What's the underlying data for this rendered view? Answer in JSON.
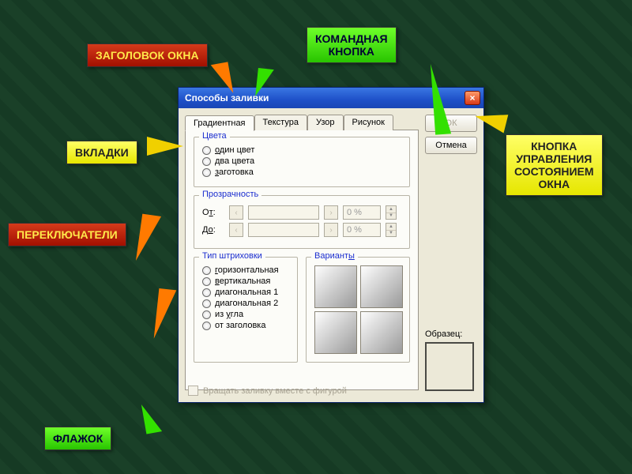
{
  "callouts": {
    "title_label": "ЗАГОЛОВОК ОКНА",
    "tabs_label": "ВКЛАДКИ",
    "radios_label": "ПЕРЕКЛЮЧАТЕЛИ",
    "checkbox_label": "ФЛАЖОК",
    "cmd_button_label": "КОМАНДНАЯ\nКНОПКА",
    "window_ctrl_label": "КНОПКА\nУПРАВЛЕНИЯ\nСОСТОЯНИЕМ\nОКНА"
  },
  "dialog": {
    "title": "Способы заливки",
    "close_glyph": "×",
    "tabs": [
      "Градиентная",
      "Текстура",
      "Узор",
      "Рисунок"
    ],
    "buttons": {
      "ok": "ОК",
      "cancel": "Отмена"
    },
    "groups": {
      "colors": {
        "legend": "Цвета",
        "options": [
          "один цвет",
          "два цвета",
          "заготовка"
        ],
        "underline_first": [
          "о",
          "д",
          "з"
        ]
      },
      "transparency": {
        "legend": "Прозрачность",
        "from_label": "От:",
        "from_u": "т",
        "to_label": "До:",
        "to_u": "о",
        "value": "0 %"
      },
      "shading": {
        "legend": "Тип штриховки",
        "options": [
          "горизонтальная",
          "вертикальная",
          "диагональная 1",
          "диагональная 2",
          "из угла",
          "от заголовка"
        ],
        "underline_first": [
          "г",
          "в",
          "",
          "",
          "у",
          ""
        ]
      },
      "variants": {
        "legend": "Варианты"
      }
    },
    "sample_label": "Образец:",
    "sample_u": "ы",
    "checkbox_label": "Вращать заливку вместе с фигурой"
  }
}
